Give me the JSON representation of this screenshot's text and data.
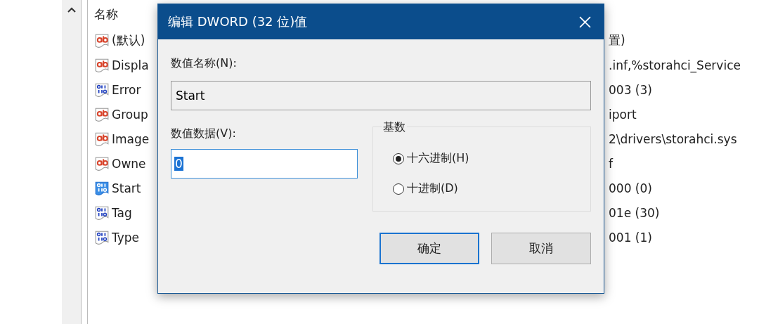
{
  "registry_list": {
    "column_header": "名称",
    "rows": [
      {
        "kind": "string",
        "name": "(默认)",
        "value": "置)",
        "selected": false
      },
      {
        "kind": "string",
        "name": "Displa",
        "value": ".inf,%storahci_Service",
        "selected": false
      },
      {
        "kind": "binary",
        "name": "Error",
        "value": "003 (3)",
        "selected": false
      },
      {
        "kind": "string",
        "name": "Group",
        "value": "iport",
        "selected": false
      },
      {
        "kind": "string",
        "name": "Image",
        "value": "2\\drivers\\storahci.sys",
        "selected": false
      },
      {
        "kind": "string",
        "name": "Owne",
        "value": "f",
        "selected": false
      },
      {
        "kind": "binary",
        "name": "Start",
        "value": "000 (0)",
        "selected": true
      },
      {
        "kind": "binary",
        "name": "Tag",
        "value": "01e (30)",
        "selected": false
      },
      {
        "kind": "binary",
        "name": "Type",
        "value": "001 (1)",
        "selected": false
      }
    ]
  },
  "dialog": {
    "title": "编辑 DWORD (32 位)值",
    "name_label": "数值名称(N):",
    "name_value": "Start",
    "data_label": "数值数据(V):",
    "data_value": "0",
    "base": {
      "label": "基数",
      "options": [
        {
          "label": "十六进制(H)",
          "selected": true
        },
        {
          "label": "十进制(D)",
          "selected": false
        }
      ]
    },
    "buttons": [
      {
        "label": "确定",
        "default": true
      },
      {
        "label": "取消",
        "default": false
      }
    ]
  }
}
